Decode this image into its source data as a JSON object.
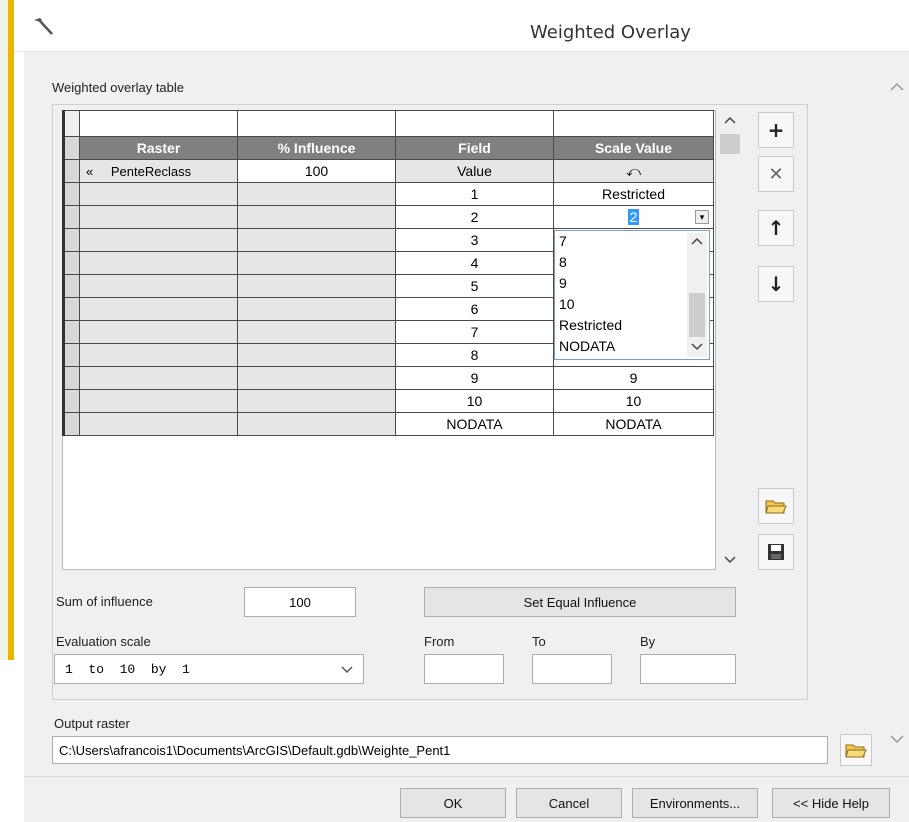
{
  "window": {
    "title": "Weighted Overlay"
  },
  "table": {
    "section_label": "Weighted overlay table",
    "headers": [
      "Raster",
      "% Influence",
      "Field",
      "Scale Value"
    ],
    "raster_row": {
      "expand": "«",
      "raster": "PenteReclass",
      "influence": "100",
      "field": "Value",
      "scale": "⤺"
    },
    "rows": [
      {
        "field": "1",
        "scale": "Restricted"
      },
      {
        "field": "2",
        "scale": "2"
      },
      {
        "field": "3",
        "scale": ""
      },
      {
        "field": "4",
        "scale": ""
      },
      {
        "field": "5",
        "scale": ""
      },
      {
        "field": "6",
        "scale": ""
      },
      {
        "field": "7",
        "scale": ""
      },
      {
        "field": "8",
        "scale": ""
      },
      {
        "field": "9",
        "scale": "9"
      },
      {
        "field": "10",
        "scale": "10"
      },
      {
        "field": "NODATA",
        "scale": "NODATA"
      }
    ]
  },
  "dropdown": {
    "options": [
      "7",
      "8",
      "9",
      "10",
      "Restricted",
      "NODATA"
    ]
  },
  "side_buttons": {
    "add": "+",
    "remove": "✕",
    "up": "↑",
    "down": "↓"
  },
  "influence": {
    "label": "Sum of influence",
    "value": "100",
    "set_equal_label": "Set Equal Influence"
  },
  "evaluation": {
    "label": "Evaluation scale",
    "selected": "1  to  10  by  1",
    "from_label": "From",
    "to_label": "To",
    "by_label": "By",
    "from_value": "",
    "to_value": "",
    "by_value": ""
  },
  "output": {
    "label": "Output raster",
    "value": "C:\\Users\\afrancois1\\Documents\\ArcGIS\\Default.gdb\\Weighte_Pent1"
  },
  "buttons": {
    "ok": "OK",
    "cancel": "Cancel",
    "environments": "Environments...",
    "hide_help": "<< Hide Help"
  },
  "colors": {
    "header_bg": "#808080",
    "selection_blue": "#3399ff",
    "dropdown_border": "#7a9bd3"
  }
}
